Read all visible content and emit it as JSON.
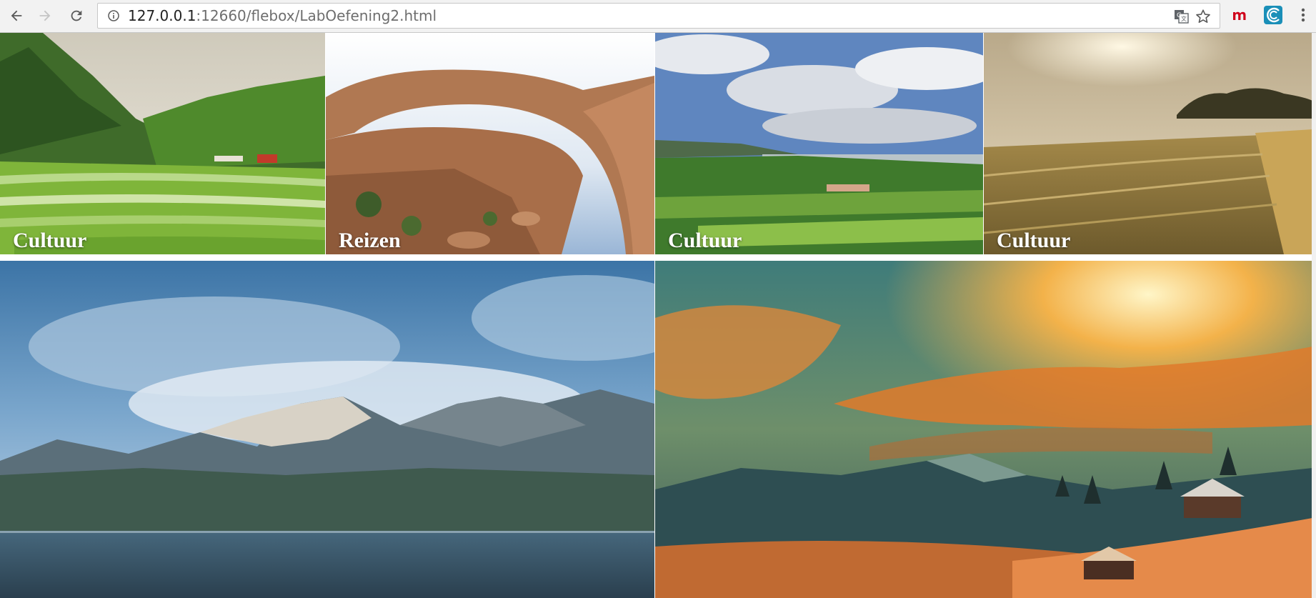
{
  "browser": {
    "url_host": "127.0.0.1",
    "url_rest": ":12660/flebox/LabOefening2.html",
    "icons": {
      "back": "back-arrow-icon",
      "forward": "forward-arrow-icon",
      "reload": "reload-icon",
      "info": "info-icon",
      "translate": "translate-icon",
      "bookmark": "star-icon",
      "extension_1": "m-extension-icon",
      "extension_2": "wave-extension-icon",
      "menu": "kebab-menu-icon"
    }
  },
  "gallery": {
    "top_row": [
      {
        "label": "Cultuur",
        "scene": "rice-terraces"
      },
      {
        "label": "Reizen",
        "scene": "rock-arch"
      },
      {
        "label": "Cultuur",
        "scene": "valley-lake"
      },
      {
        "label": "Cultuur",
        "scene": "wheat-field"
      }
    ],
    "bottom_row": [
      {
        "scene": "mountain-lake"
      },
      {
        "scene": "painted-sunset-village"
      }
    ]
  },
  "colors": {
    "label_text": "#ffffff",
    "extension_m": "#d0021b",
    "extension_wave": "#1a8fb8"
  }
}
